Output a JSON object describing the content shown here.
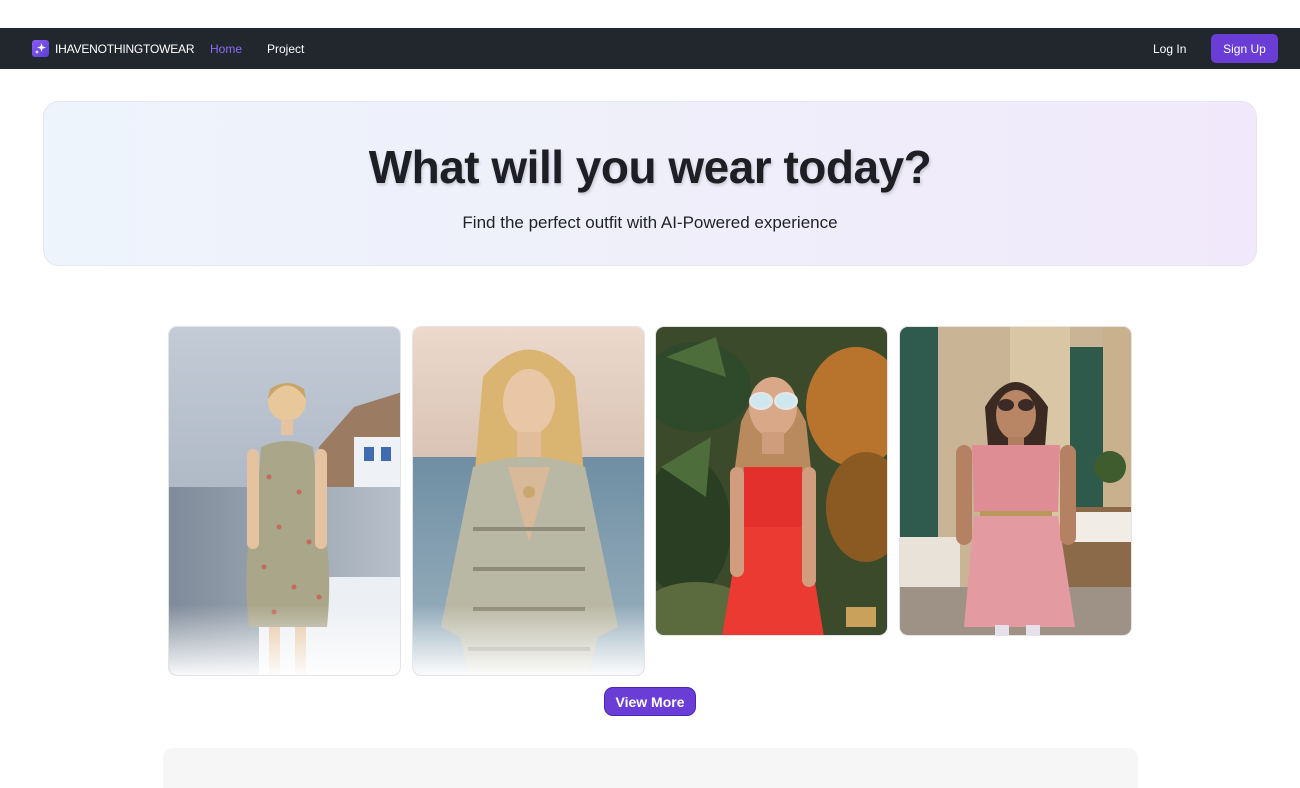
{
  "navbar": {
    "brand": "IHAVENOTHINGTOWEAR",
    "links": [
      {
        "label": "Home",
        "active": true
      },
      {
        "label": "Project",
        "active": false
      }
    ],
    "login_label": "Log In",
    "signup_label": "Sign Up",
    "background": "#22262d",
    "accent": "#6a3ed6"
  },
  "hero": {
    "title": "What will you wear today?",
    "subtitle": "Find the perfect outfit with AI-Powered experience"
  },
  "gallery": {
    "cards": [
      {
        "name": "outfit-floral-sundress"
      },
      {
        "name": "outfit-boho-lace-tunic"
      },
      {
        "name": "outfit-red-tiered-dress"
      },
      {
        "name": "outfit-pink-wrap-dress"
      }
    ],
    "view_more_label": "View More"
  }
}
